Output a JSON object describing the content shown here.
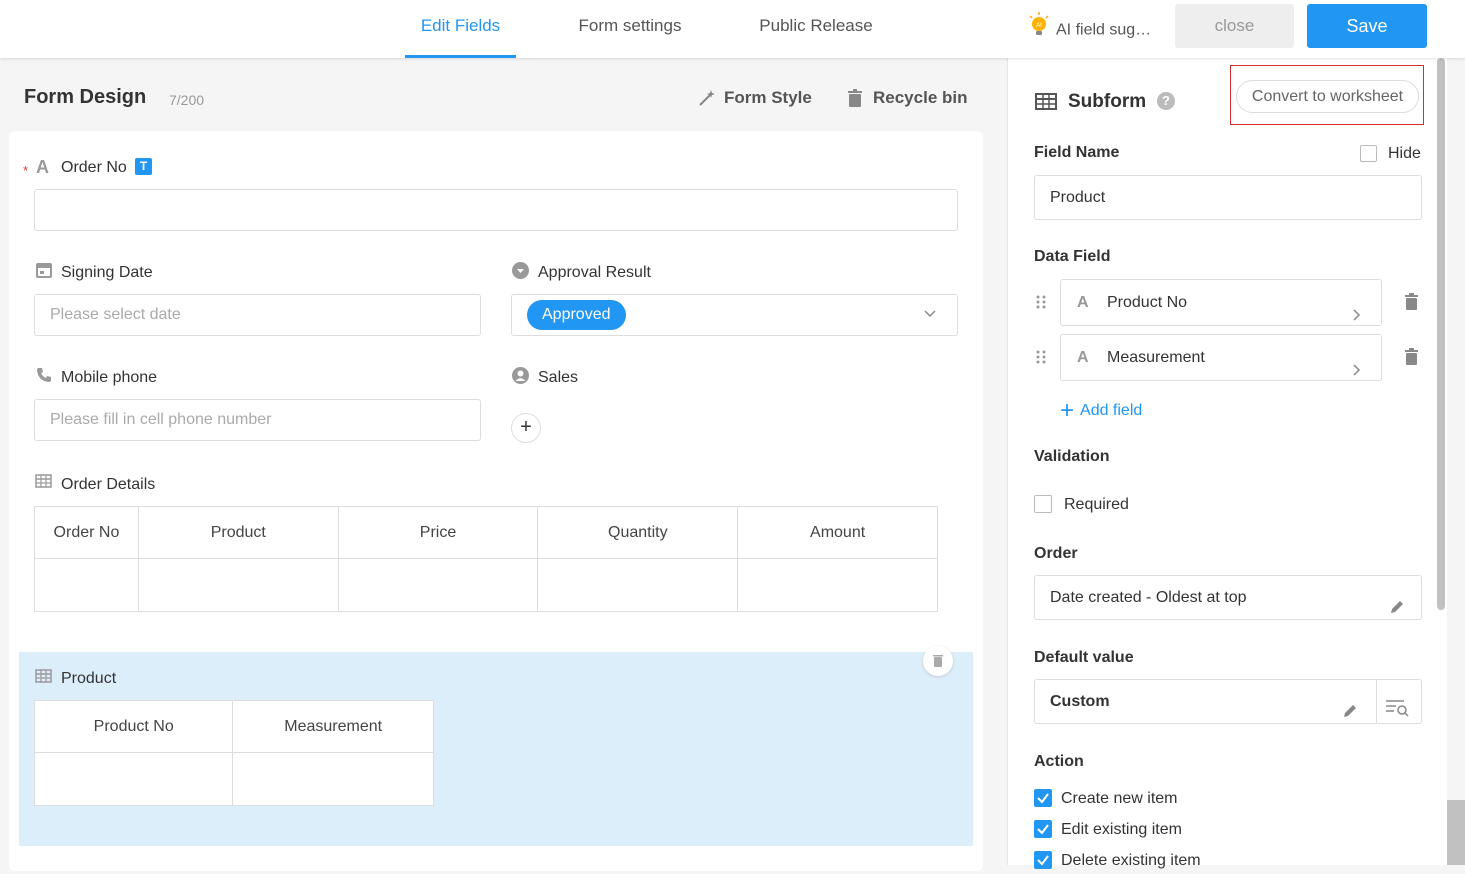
{
  "tabs": [
    "Edit Fields",
    "Form settings",
    "Public Release"
  ],
  "header": {
    "ai_label": "AI field sug…",
    "ai_badge": "AI",
    "close": "close",
    "save": "Save"
  },
  "form": {
    "title": "Form Design",
    "count": "7/200",
    "style_link": "Form Style",
    "recycle_link": "Recycle bin"
  },
  "fields": {
    "order_no": {
      "label": "Order No",
      "badge": "T",
      "required_mark": "*"
    },
    "signing_date": {
      "label": "Signing Date",
      "placeholder": "Please select date"
    },
    "approval": {
      "label": "Approval Result",
      "value": "Approved"
    },
    "mobile": {
      "label": "Mobile phone",
      "placeholder": "Please fill in cell phone number"
    },
    "sales": {
      "label": "Sales"
    },
    "order_details": {
      "label": "Order Details",
      "columns": [
        "Order No",
        "Product",
        "Price",
        "Quantity",
        "Amount"
      ]
    },
    "product": {
      "label": "Product",
      "columns": [
        "Product No",
        "Measurement"
      ]
    }
  },
  "panel": {
    "title": "Subform",
    "convert": "Convert to worksheet",
    "field_name_label": "Field Name",
    "hide_label": "Hide",
    "field_name_value": "Product",
    "data_field_label": "Data Field",
    "data_fields": [
      "Product No",
      "Measurement"
    ],
    "add_field": "Add field",
    "validation_label": "Validation",
    "required_label": "Required",
    "order_label": "Order",
    "order_value": "Date created - Oldest at top",
    "default_label": "Default value",
    "default_value": "Custom",
    "action_label": "Action",
    "actions": [
      "Create new item",
      "Edit existing item",
      "Delete existing item"
    ]
  },
  "colors": {
    "accent": "#2196f3",
    "highlight": "#ddeefb",
    "convert_outline": "#d32f2f"
  }
}
